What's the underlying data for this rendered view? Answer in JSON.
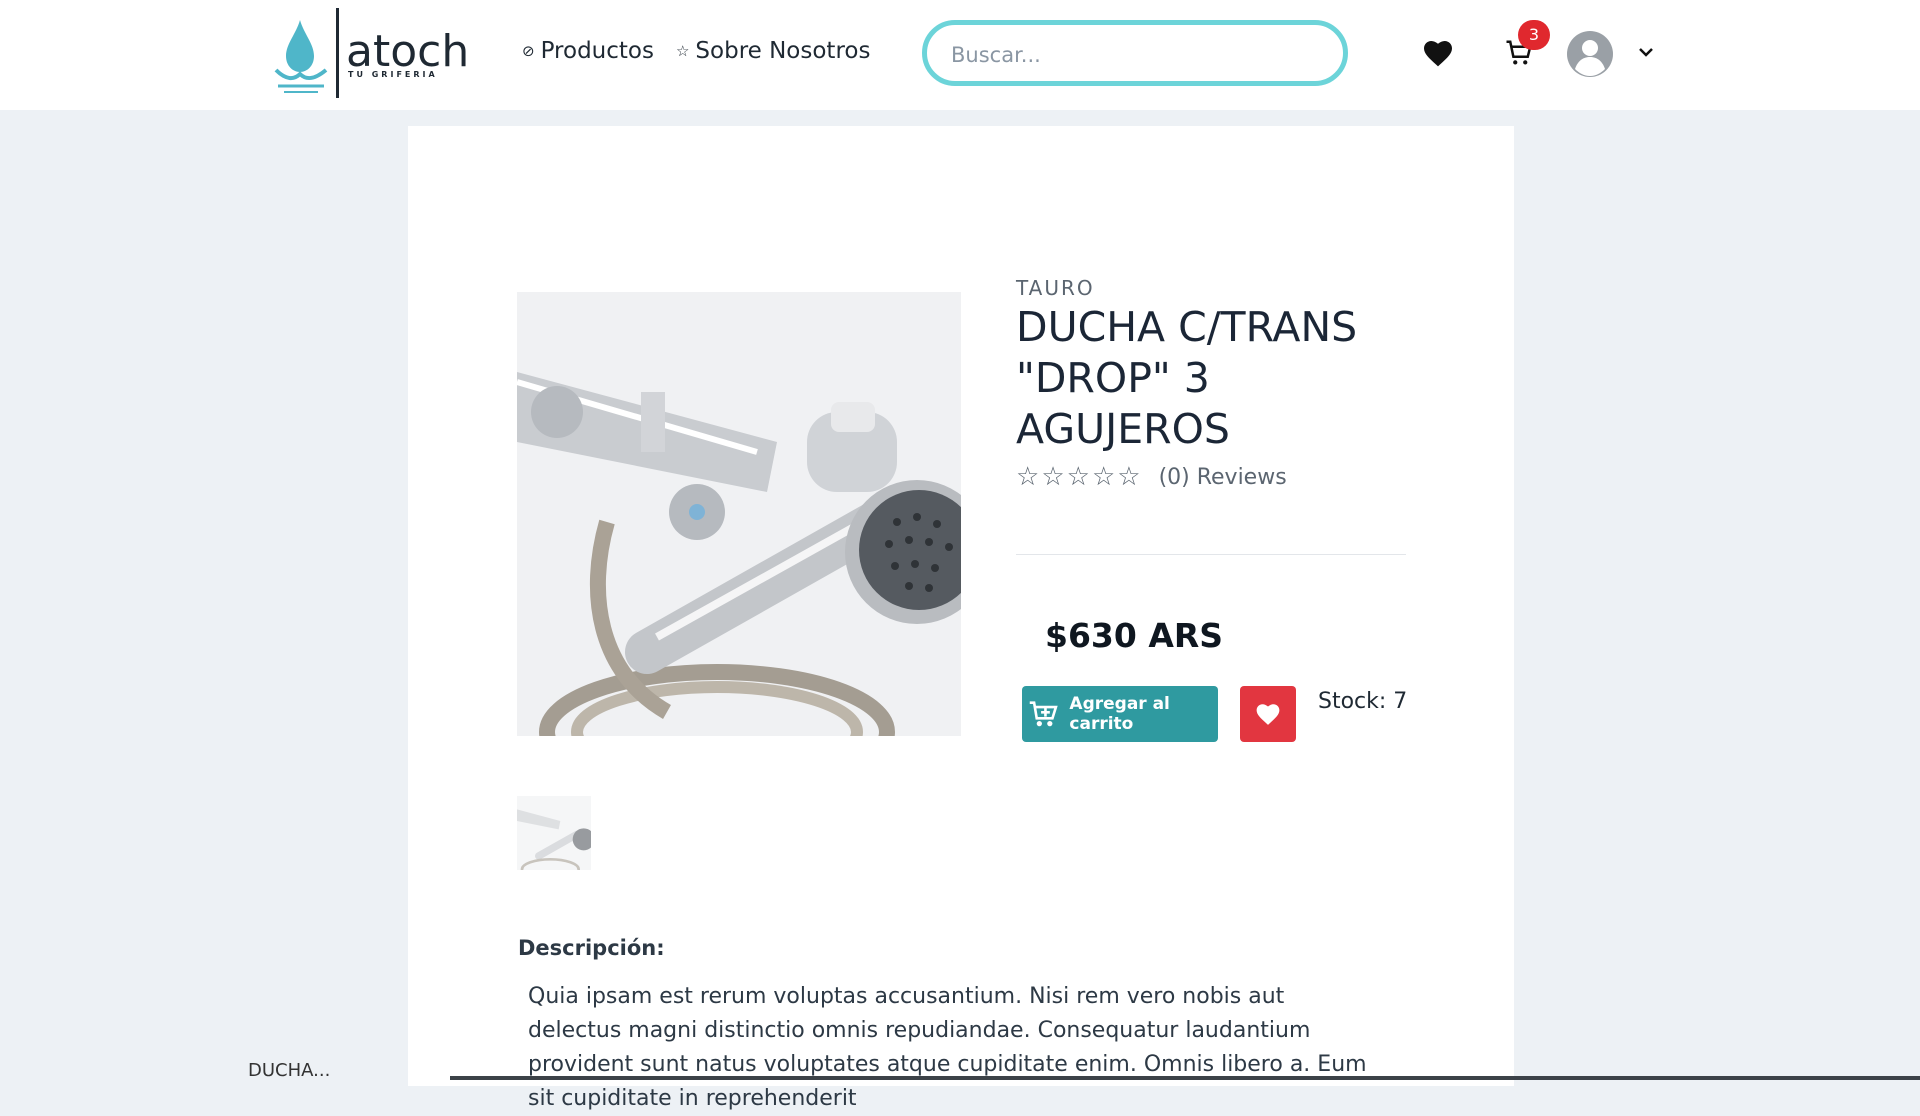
{
  "header": {
    "logo_text": "atoch",
    "logo_tagline": "TU GRIFERIA",
    "nav": [
      {
        "label": "Productos",
        "icon": "compass-icon"
      },
      {
        "label": "Sobre Nosotros",
        "icon": "star-icon"
      }
    ],
    "search_placeholder": "Buscar...",
    "cart_count": "3"
  },
  "product": {
    "brand": "TAURO",
    "title": "DUCHA C/TRANS \"DROP\" 3 AGUJEROS",
    "reviews_label": "(0) Reviews",
    "rating": 0,
    "rating_max": 5,
    "price": "$630 ARS",
    "add_to_cart_label": "Agregar al carrito",
    "stock_label": "Stock: 7"
  },
  "description": {
    "title": "Descripción:",
    "text": "Quia ipsam est rerum voluptas accusantium. Nisi rem vero nobis aut delectus magni distinctio omnis repudiandae. Consequatur laudantium provident sunt natus voluptates atque cupiditate enim. Omnis libero a. Eum sit cupiditate in reprehenderit"
  },
  "colors": {
    "accent": "#2f9aa0",
    "favorite": "#e23640",
    "badge": "#e0282e",
    "search_border": "#6cd4d9"
  },
  "footer_fragment": "DUCHA..."
}
